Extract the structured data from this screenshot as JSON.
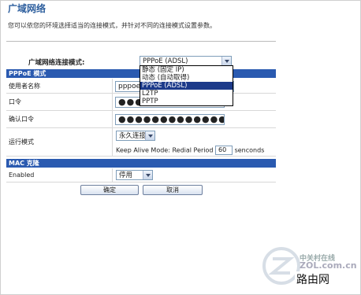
{
  "page": {
    "title": "广域网络",
    "description": "您可以依您的环境选择适当的连接模式，并针对不同的连接模式设置参数。"
  },
  "wan_mode": {
    "label": "广域网络连接模式:",
    "value": "PPPoE (ADSL)",
    "options": [
      "静态 (固定 IP)",
      "动态 (自动取得)",
      "PPPoE (ADSL)",
      "L2TP",
      "PPTP"
    ],
    "selected_index": 2
  },
  "pppoe": {
    "section_title": "PPPoE 模式",
    "username_label": "使用者名称",
    "username_value": "pppoe_",
    "password_label": "口令",
    "password_value": "●●●●●●●●●●●●●●●",
    "confirm_label": "确认口令",
    "confirm_value": "●●●●●●●●●●●●●●●",
    "run_mode_label": "运行模式",
    "run_mode_value": "永久连接",
    "keepalive_prefix": "Keep Alive Mode: Redial Period",
    "keepalive_value": "60",
    "keepalive_suffix": "senconds"
  },
  "mac_clone": {
    "section_title": "MAC 克隆",
    "enabled_label": "Enabled",
    "enabled_value": "停用"
  },
  "buttons": {
    "ok": "确定",
    "cancel": "取消"
  },
  "watermark": {
    "site": "中关村在线",
    "zol": "ZOL.com.cn",
    "router": "路由网"
  },
  "colors": {
    "title": "#2e5f9e",
    "section_bar": "#2a5ab0",
    "selected_option": "#1c3a8a"
  }
}
